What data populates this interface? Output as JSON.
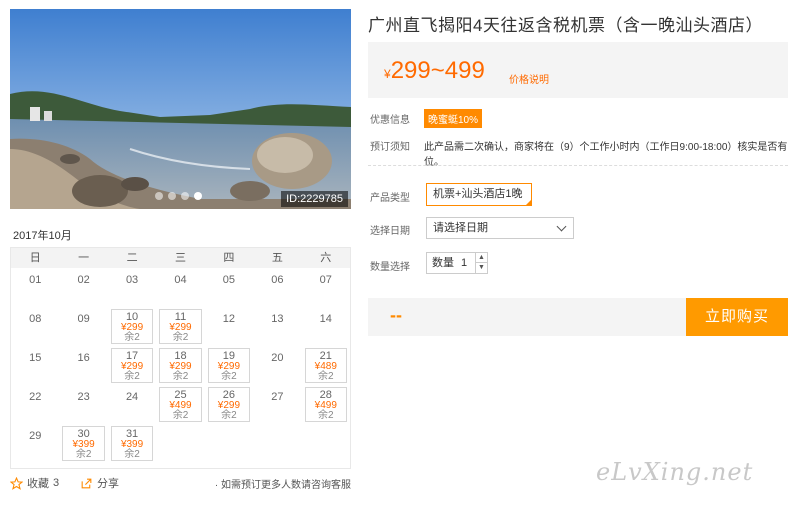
{
  "product": {
    "title": "广州直飞揭阳4天往返含税机票（含一晚汕头酒店）",
    "price_currency": "¥",
    "price_range": "299~499",
    "price_note": "价格说明"
  },
  "photo": {
    "id_label": "ID:2229785",
    "slide_count": 4,
    "active_slide": 4
  },
  "calendar": {
    "month": "2017年10月",
    "weekdays": [
      "日",
      "一",
      "二",
      "三",
      "四",
      "五",
      "六"
    ],
    "leading_blank_days": 0,
    "days": [
      {
        "day": "01"
      },
      {
        "day": "02"
      },
      {
        "day": "03"
      },
      {
        "day": "04"
      },
      {
        "day": "05"
      },
      {
        "day": "06"
      },
      {
        "day": "07"
      },
      {
        "day": "08"
      },
      {
        "day": "09"
      },
      {
        "day": "10",
        "price": "¥299",
        "stock": "余2"
      },
      {
        "day": "11",
        "price": "¥299",
        "stock": "余2"
      },
      {
        "day": "12"
      },
      {
        "day": "13"
      },
      {
        "day": "14"
      },
      {
        "day": "15"
      },
      {
        "day": "16"
      },
      {
        "day": "17",
        "price": "¥299",
        "stock": "余2"
      },
      {
        "day": "18",
        "price": "¥299",
        "stock": "余2"
      },
      {
        "day": "19",
        "price": "¥299",
        "stock": "余2"
      },
      {
        "day": "20"
      },
      {
        "day": "21",
        "price": "¥489",
        "stock": "余2"
      },
      {
        "day": "22"
      },
      {
        "day": "23"
      },
      {
        "day": "24"
      },
      {
        "day": "25",
        "price": "¥499",
        "stock": "余2"
      },
      {
        "day": "26",
        "price": "¥299",
        "stock": "余2"
      },
      {
        "day": "27"
      },
      {
        "day": "28",
        "price": "¥499",
        "stock": "余2"
      },
      {
        "day": "29"
      },
      {
        "day": "30",
        "price": "¥399",
        "stock": "余2"
      },
      {
        "day": "31",
        "price": "¥399",
        "stock": "余2"
      }
    ]
  },
  "actions": {
    "favorite_label": "收藏",
    "favorite_count": "3",
    "share_label": "分享",
    "consult_text": "· 如需预订更多人数请咨询客服"
  },
  "info": {
    "promo_label": "优惠信息",
    "promo_badge": "晚蜜蜓10%",
    "notice_label": "预订须知",
    "notice_text": "此产品需二次确认，商家将在（9）个工作小时内（工作日9:00-18:00）核实是否有位。"
  },
  "options": {
    "type_label": "产品类型",
    "type_value": "机票+汕头酒店1晚",
    "date_label": "选择日期",
    "date_value": "请选择日期",
    "qty_label": "数量选择",
    "qty_field_label": "数量",
    "qty_value": "1",
    "qty_up": "▲",
    "qty_down": "▼"
  },
  "purchase": {
    "total": "--",
    "buy_label": "立即购买"
  },
  "watermark": "eLvXing.net",
  "colors": {
    "accent": "#ff8a00",
    "price": "#ff6a00",
    "buy_button": "#ff9a00",
    "panel_bg": "#f4f4f4"
  },
  "icons": {
    "favorite": "star-icon",
    "share": "share-icon",
    "date_dropdown": "chevron-down-icon"
  }
}
